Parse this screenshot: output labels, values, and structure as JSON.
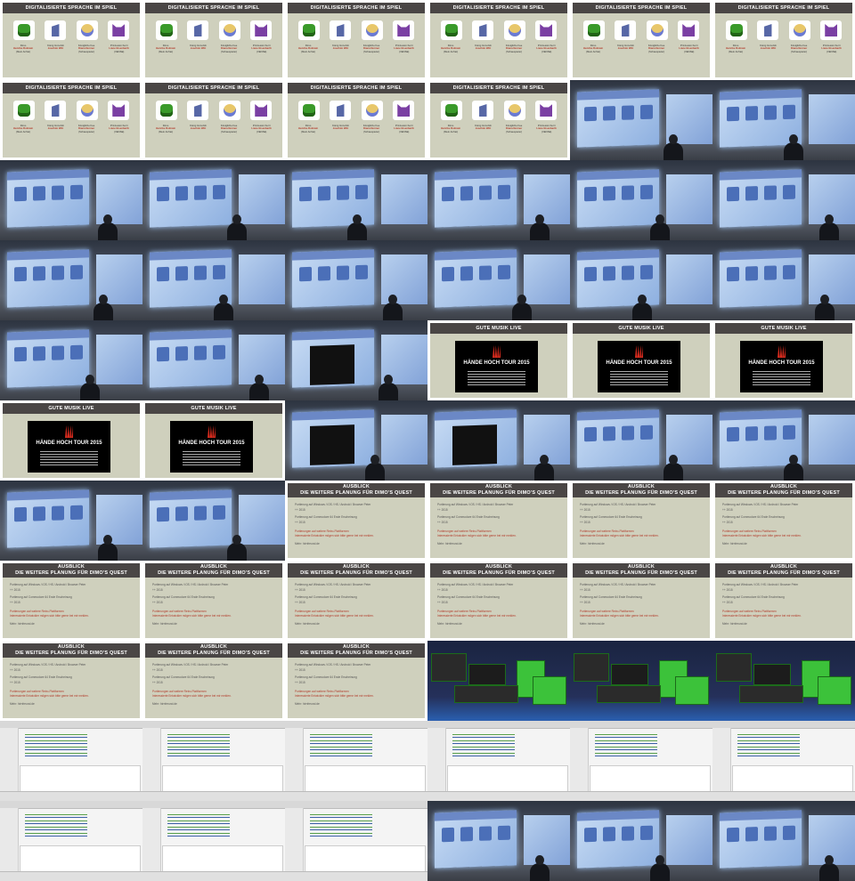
{
  "tiles": [
    {
      "kind": "sprites"
    },
    {
      "kind": "sprites"
    },
    {
      "kind": "sprites"
    },
    {
      "kind": "sprites"
    },
    {
      "kind": "sprites"
    },
    {
      "kind": "sprites"
    },
    {
      "kind": "sprites"
    },
    {
      "kind": "sprites"
    },
    {
      "kind": "sprites"
    },
    {
      "kind": "sprites"
    },
    {
      "kind": "photo"
    },
    {
      "kind": "photo"
    },
    {
      "kind": "photo"
    },
    {
      "kind": "photo"
    },
    {
      "kind": "photo"
    },
    {
      "kind": "photo"
    },
    {
      "kind": "photo"
    },
    {
      "kind": "photo"
    },
    {
      "kind": "photo"
    },
    {
      "kind": "photo"
    },
    {
      "kind": "photo"
    },
    {
      "kind": "photo"
    },
    {
      "kind": "photo"
    },
    {
      "kind": "photo"
    },
    {
      "kind": "photo"
    },
    {
      "kind": "photo"
    },
    {
      "kind": "photo-concert"
    },
    {
      "kind": "concert"
    },
    {
      "kind": "concert"
    },
    {
      "kind": "concert"
    },
    {
      "kind": "concert"
    },
    {
      "kind": "concert"
    },
    {
      "kind": "photo-concert"
    },
    {
      "kind": "photo-concert"
    },
    {
      "kind": "photo"
    },
    {
      "kind": "photo"
    },
    {
      "kind": "photo"
    },
    {
      "kind": "photo"
    },
    {
      "kind": "ausblick"
    },
    {
      "kind": "ausblick"
    },
    {
      "kind": "ausblick"
    },
    {
      "kind": "ausblick"
    },
    {
      "kind": "ausblick"
    },
    {
      "kind": "ausblick"
    },
    {
      "kind": "ausblick"
    },
    {
      "kind": "ausblick"
    },
    {
      "kind": "ausblick"
    },
    {
      "kind": "ausblick"
    },
    {
      "kind": "ausblick"
    },
    {
      "kind": "ausblick"
    },
    {
      "kind": "ausblick"
    },
    {
      "kind": "game"
    },
    {
      "kind": "game"
    },
    {
      "kind": "game"
    },
    {
      "kind": "ide"
    },
    {
      "kind": "ide"
    },
    {
      "kind": "ide"
    },
    {
      "kind": "ide"
    },
    {
      "kind": "ide"
    },
    {
      "kind": "ide"
    },
    {
      "kind": "ide"
    },
    {
      "kind": "ide"
    },
    {
      "kind": "ide"
    },
    {
      "kind": "photo"
    },
    {
      "kind": "photo"
    },
    {
      "kind": "photo"
    }
  ],
  "slides": {
    "sprites": {
      "title": "DIGITALISIERTE SPRACHE IM SPIEL",
      "chars": [
        {
          "name": "Dimo",
          "voice": "Henrike Rolmain",
          "note": "(Mein Anfrat)"
        },
        {
          "name": "König Gnnofob",
          "voice": "Joachim Witt",
          "note": ""
        },
        {
          "name": "Königliche Fee",
          "voice": "Diana Nermer",
          "note": "(Schauspieler)"
        },
        {
          "name": "Prinzessin Kerri",
          "voice": "Liane Eisenbarth",
          "note": "(XENSE)"
        }
      ]
    },
    "concert": {
      "title": "GUTE MUSIK LIVE",
      "poster": "HÄNDE HOCH TOUR 2015"
    },
    "ausblick": {
      "title1": "AUSBLICK",
      "title2": "DIE WEITERE PLANUNG FÜR DIMO'S QUEST",
      "line1": "Portierung auf Windows / iOS / HS / Android / Browser Peter",
      "line2": "++ 2015",
      "line3": "Portierung auf Commodore 64 Ende Erscheinung",
      "line4": "++ 2015",
      "line5": "Portierungen auf weitere Retro-Plattformen",
      "line6": "Interessierte Entwickler mögen sich bitte gerne bei mir melden.",
      "line7": "Mehr: hirnfreund.de"
    }
  },
  "colors": {
    "slide_bg": "#cfd0bd",
    "slide_bar": "#4a4645",
    "accent_red": "#b23b2b"
  }
}
